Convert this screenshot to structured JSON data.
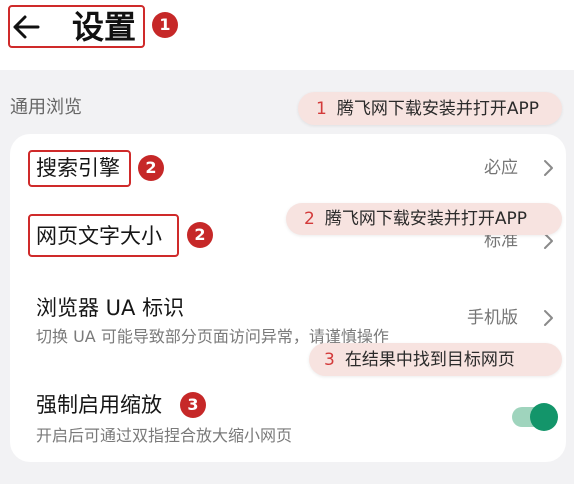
{
  "header": {
    "back_icon": "arrow-left-icon",
    "title": "设置",
    "step_badge": "1"
  },
  "section": {
    "label": "通用浏览"
  },
  "settings": {
    "search_engine": {
      "title": "搜索引擎",
      "value": "必应",
      "step_badge": "2",
      "chevron_icon": "chevron-right-icon"
    },
    "font_size": {
      "title": "网页文字大小",
      "value": "标准",
      "step_badge": "2",
      "chevron_icon": "chevron-right-icon"
    },
    "user_agent": {
      "title": "浏览器 UA 标识",
      "description": "切换 UA 可能导致部分页面访问异常，请谨慎操作",
      "value": "手机版",
      "chevron_icon": "chevron-right-icon"
    },
    "force_zoom": {
      "title": "强制启用缩放",
      "description": "开启后可通过双指捏合放大缩小网页",
      "step_badge": "3",
      "toggle_on": true
    }
  },
  "step_callouts": [
    {
      "number": "1",
      "text": "腾飞网下载安装并打开APP"
    },
    {
      "number": "2",
      "text": "腾飞网下载安装并打开APP"
    },
    {
      "number": "3",
      "text": "在结果中找到目标网页"
    }
  ],
  "colors": {
    "annotation_red": "#cf2a2a",
    "badge_red": "#c62828",
    "callout_background": "#f7e3e0",
    "toggle_on_green": "#13956a",
    "toggle_track_green": "#9fd4bd",
    "page_background": "#f2f2f4"
  }
}
